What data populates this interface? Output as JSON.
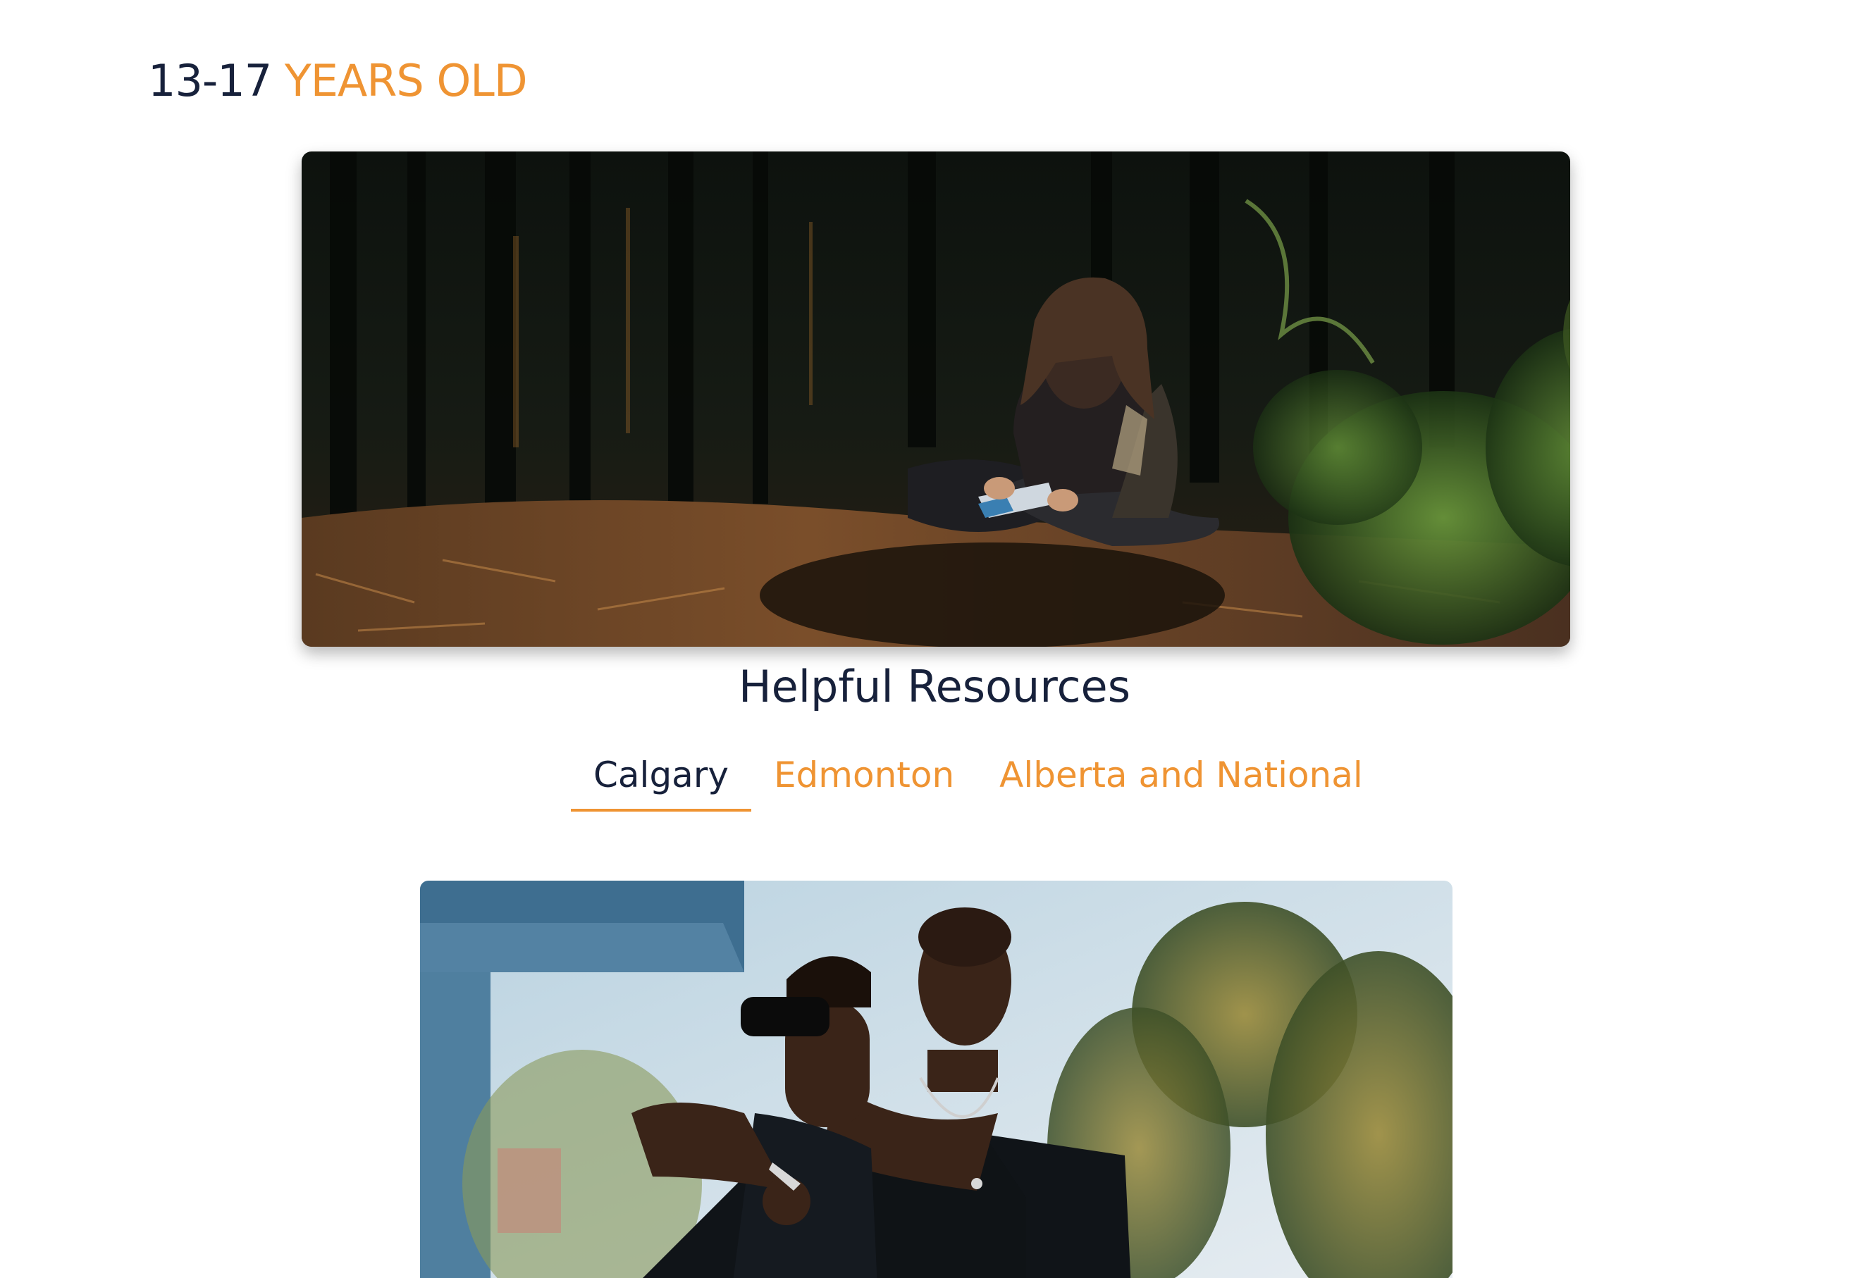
{
  "heading": {
    "age_range": "13-17",
    "suffix": "YEARS OLD"
  },
  "hero_image": {
    "icon": "photo-person-sitting-in-forest"
  },
  "resources": {
    "title": "Helpful Resources",
    "tabs": [
      {
        "label": "Calgary",
        "active": true
      },
      {
        "label": "Edmonton",
        "active": false
      },
      {
        "label": "Alberta and National",
        "active": false
      }
    ]
  },
  "second_image": {
    "icon": "photo-two-men-outdoors"
  },
  "colors": {
    "navy": "#17213b",
    "accent": "#ef9433",
    "background": "#ffffff"
  }
}
